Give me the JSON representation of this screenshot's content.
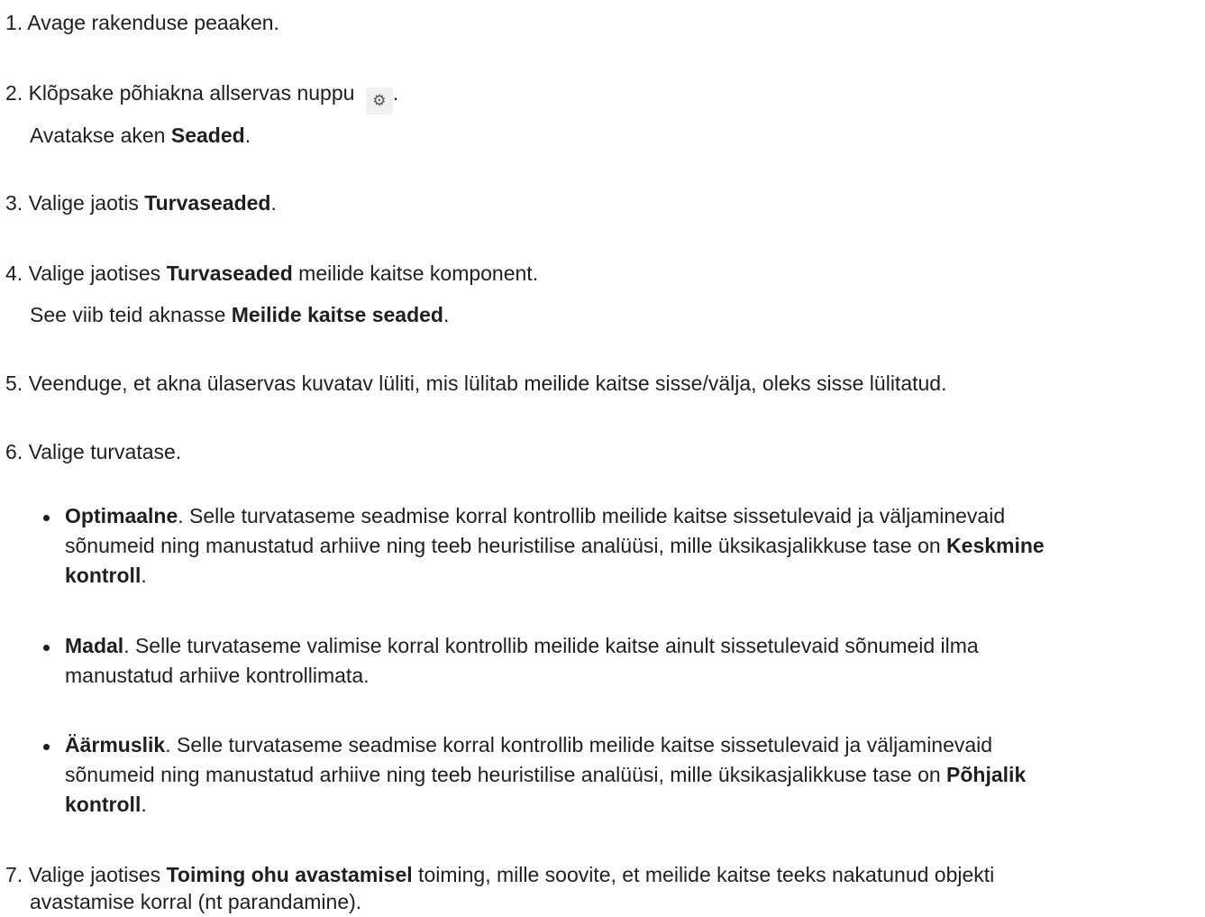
{
  "steps": [
    {
      "text": "1. Avage rakenduse peaaken."
    },
    {
      "pre": "2. Klõpsake põhiakna allservas nuppu ",
      "icon": "gear-icon",
      "post": "."
    },
    {
      "pre": "Avatakse aken ",
      "bold": "Seaded",
      "post": "."
    },
    {
      "pre": "3. Valige jaotis ",
      "bold": "Turvaseaded",
      "post": "."
    },
    {
      "pre": "4. Valige jaotises ",
      "bold": "Turvaseaded",
      "post": " meilide kaitse komponent."
    },
    {
      "pre": "See viib teid aknasse ",
      "bold": "Meilide kaitse seaded",
      "post": "."
    },
    {
      "text": "5. Veenduge, et akna ülaservas kuvatav lüliti, mis lülitab meilide kaitse sisse/välja, oleks sisse lülitatud."
    },
    {
      "text": "6. Valige turvatase."
    }
  ],
  "levels": [
    {
      "name": "Optimaalne",
      "line1": ". Selle turvataseme seadmise korral kontrollib meilide kaitse sissetulevaid ja väljaminevaid",
      "line2_pre": "sõnumeid ning manustatud arhiive ning teeb heuristilise analüüsi, mille üksikasjalikkuse tase on ",
      "line2_bold": "Keskmine",
      "line3_bold": "kontroll",
      "line3_post": "."
    },
    {
      "name": "Madal",
      "line1": ". Selle turvataseme valimise korral kontrollib meilide kaitse ainult sissetulevaid sõnumeid ilma",
      "line2_pre": "manustatud arhiive kontrollimata.",
      "line2_bold": "",
      "line3_bold": "",
      "line3_post": ""
    },
    {
      "name": "Äärmuslik",
      "line1": ". Selle turvataseme seadmise korral kontrollib meilide kaitse sissetulevaid ja väljaminevaid",
      "line2_pre": "sõnumeid ning manustatud arhiive ning teeb heuristilise analüüsi, mille üksikasjalikkuse tase on ",
      "line2_bold": "Põhjalik",
      "line3_bold": "kontroll",
      "line3_post": "."
    }
  ],
  "step7": {
    "pre": "7. Valige jaotises ",
    "bold": "Toiming ohu avastamisel",
    "post": " toiming, mille soovite, et meilide kaitse teeks nakatunud objekti",
    "line2": "avastamise korral (nt parandamine)."
  },
  "icons": {
    "gear": "⚙"
  }
}
